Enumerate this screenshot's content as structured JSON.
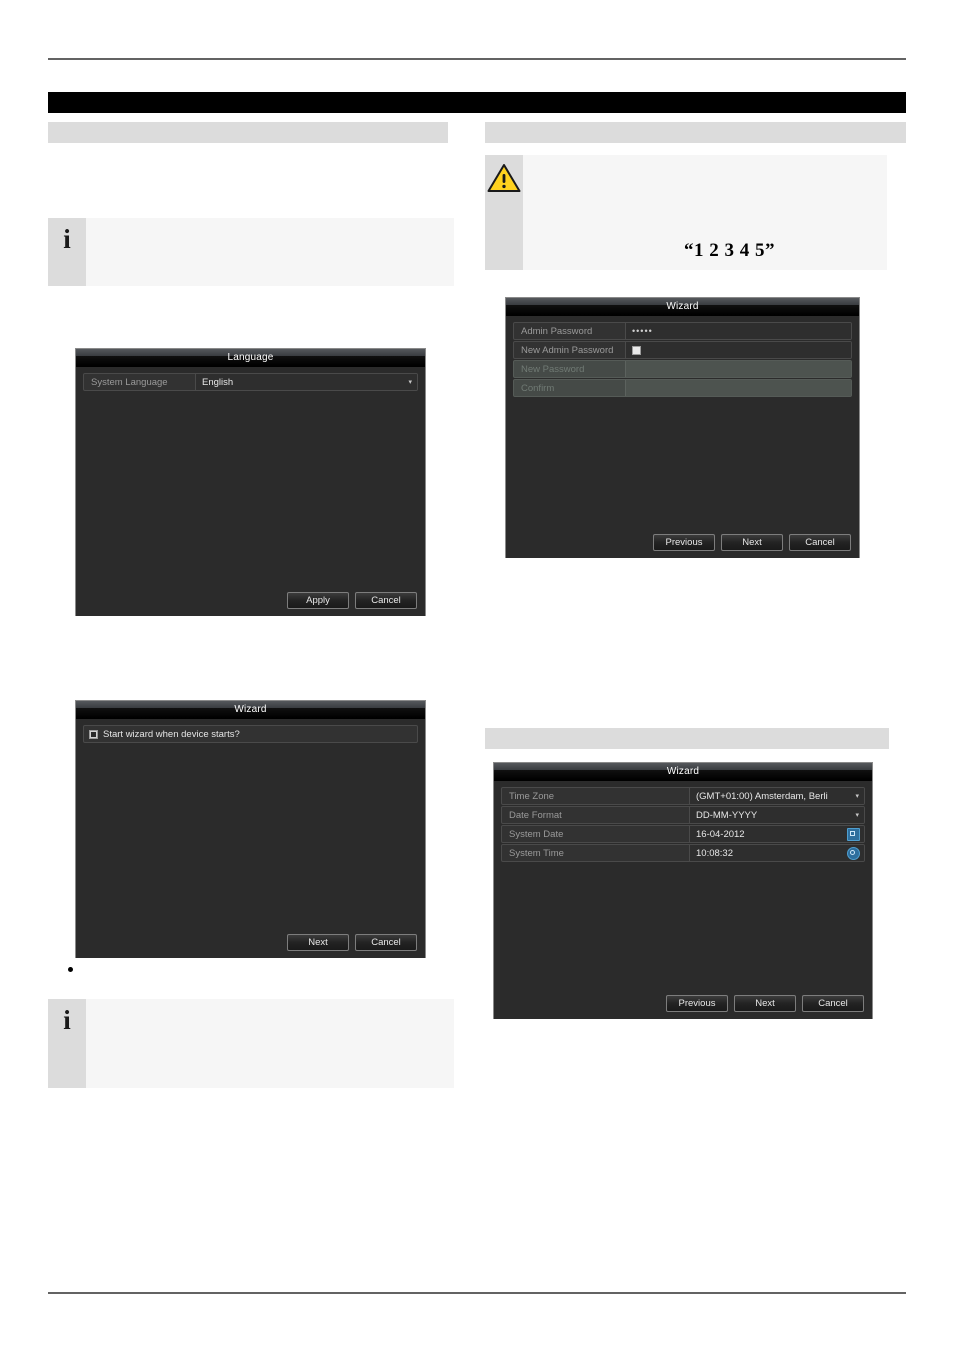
{
  "page": {
    "chapter_bar": "",
    "section_headings": [
      "",
      "",
      ""
    ],
    "callouts": {
      "note_top_left": {
        "icon": "info-icon",
        "text": ""
      },
      "note_bottom_left": {
        "icon": "info-icon",
        "text": ""
      },
      "warning_right": {
        "icon": "warning-triangle-icon",
        "text": "",
        "emphasis": "“1 2 3 4 5”"
      }
    },
    "bullet": ""
  },
  "dialogs": {
    "language": {
      "title": "Language",
      "rows": [
        {
          "label": "System Language",
          "value": "English",
          "control": "dropdown"
        }
      ],
      "buttons": [
        "Apply",
        "Cancel"
      ]
    },
    "wizard_start": {
      "title": "Wizard",
      "checkbox": {
        "label": "Start wizard when device starts?",
        "checked": true
      },
      "buttons": [
        "Next",
        "Cancel"
      ]
    },
    "wizard_password": {
      "title": "Wizard",
      "rows": [
        {
          "label": "Admin Password",
          "value": "•••••",
          "control": "password",
          "disabled": false
        },
        {
          "label": "New Admin Password",
          "value": "",
          "control": "checkbox",
          "checked": false,
          "disabled": false
        },
        {
          "label": "New Password",
          "value": "",
          "control": "text",
          "disabled": true
        },
        {
          "label": "Confirm",
          "value": "",
          "control": "text",
          "disabled": true
        }
      ],
      "buttons": [
        "Previous",
        "Next",
        "Cancel"
      ]
    },
    "wizard_time": {
      "title": "Wizard",
      "rows": [
        {
          "label": "Time Zone",
          "value": "(GMT+01:00) Amsterdam, Berli",
          "control": "dropdown"
        },
        {
          "label": "Date Format",
          "value": "DD-MM-YYYY",
          "control": "dropdown"
        },
        {
          "label": "System Date",
          "value": "16-04-2012",
          "control": "calendar",
          "icon": "calendar-icon"
        },
        {
          "label": "System Time",
          "value": "10:08:32",
          "control": "time",
          "icon": "clock-icon"
        }
      ],
      "buttons": [
        "Previous",
        "Next",
        "Cancel"
      ]
    }
  },
  "colors": {
    "chapter_bar": "#000000",
    "section_bar": "#dcdcdc",
    "callout_body": "#f6f6f6",
    "callout_icon_cell": "#dcdcdc",
    "rule": "#636363",
    "dialog_bg": "#2b2b2b",
    "dialog_border": "#8a8a8a",
    "accent_icon": "#2e6f9e",
    "warning_yellow": "#ffd21e"
  }
}
